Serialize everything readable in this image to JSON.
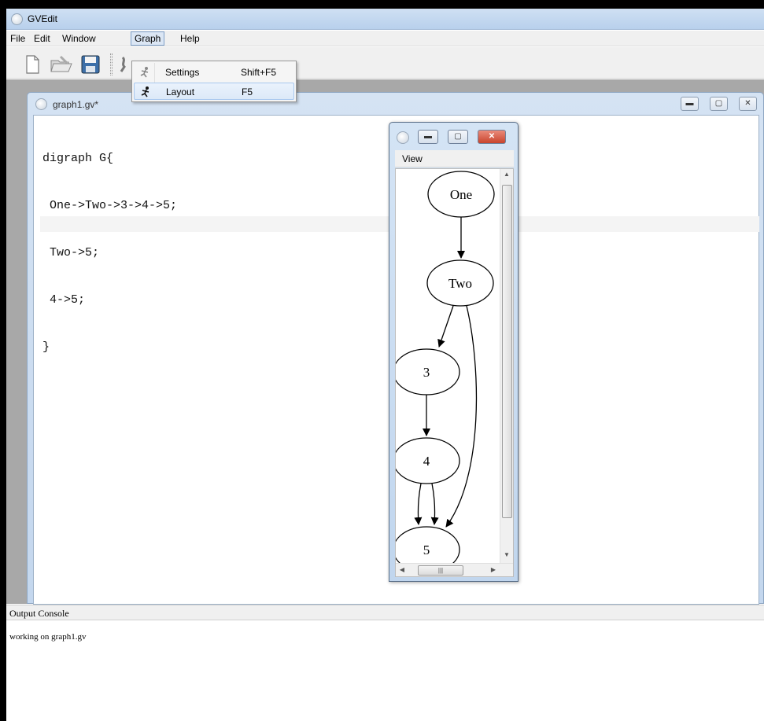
{
  "app": {
    "title": "GVEdit"
  },
  "menu": {
    "file": "File",
    "edit": "Edit",
    "window": "Window",
    "graph": "Graph",
    "help": "Help"
  },
  "graph_menu": {
    "items": [
      {
        "label": "Settings",
        "shortcut": "Shift+F5",
        "icon": "settings-runner-icon"
      },
      {
        "label": "Layout",
        "shortcut": "F5",
        "icon": "layout-runner-icon"
      }
    ]
  },
  "toolbar": {
    "icons": [
      "new-file-icon",
      "open-folder-icon",
      "save-disk-icon",
      "run-icon"
    ]
  },
  "document": {
    "title": "graph1.gv*",
    "code": [
      "digraph G{",
      " One->Two->3->4->5;",
      " Two->5;",
      " 4->5;",
      "}"
    ]
  },
  "view_window": {
    "menu_view": "View",
    "nodes": [
      "One",
      "Two",
      "3",
      "4",
      "5"
    ],
    "edges": [
      [
        "One",
        "Two"
      ],
      [
        "Two",
        "3"
      ],
      [
        "3",
        "4"
      ],
      [
        "4",
        "5"
      ],
      [
        "4",
        "5"
      ],
      [
        "Two",
        "5"
      ]
    ]
  },
  "console": {
    "title": "Output Console",
    "text": "working on graph1.gv"
  },
  "colors": {
    "titlebar": "#c4d8f0",
    "mdi_background": "#a8a8a8",
    "menu_highlight": "#dbe6f4"
  }
}
